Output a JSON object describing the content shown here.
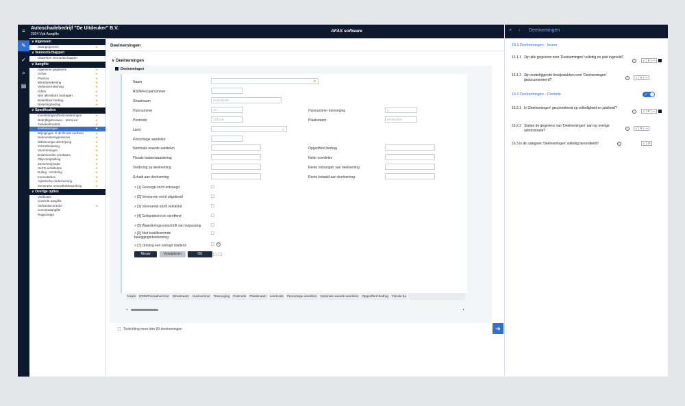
{
  "window": {
    "title": "Autoschadebedrijf \"De Uitdeuker\" B.V.",
    "subtitle": "2024 Vpb Aangifte",
    "brand": "AFAS software"
  },
  "rail_icons": [
    "menu-icon",
    "pencil-icon",
    "check-icon",
    "search-icon",
    "document-icon"
  ],
  "nav": {
    "sections": [
      {
        "title": "Algemeen",
        "items": [
          {
            "label": "Stamgegevens",
            "star": true
          }
        ]
      },
      {
        "title": "Vennootschappen",
        "items": [
          {
            "label": "Uitwerken vennootschappen",
            "star": false
          }
        ]
      },
      {
        "title": "Aangifte",
        "items": [
          {
            "label": "Algemene gegevens",
            "star": true
          },
          {
            "label": "Activa",
            "star": true
          },
          {
            "label": "Passiva",
            "star": true
          },
          {
            "label": "Winstberekening",
            "star": true
          },
          {
            "label": "Verliesverrekening",
            "star": true
          },
          {
            "label": "Giften",
            "star": true
          },
          {
            "label": "Niet aftrekbare bedragen",
            "star": true
          },
          {
            "label": "Belastbaar bedrag",
            "star": true
          },
          {
            "label": "Belastingbedrag",
            "star": true
          }
        ]
      },
      {
        "title": "Specificaties",
        "items": [
          {
            "label": "Investeringen/Desinvesteringen",
            "star": true
          },
          {
            "label": "Bedrijfsgebouwen - terreinen",
            "star": true
          },
          {
            "label": "Aandeelhouders",
            "star": true
          },
          {
            "label": "Deelnemingen",
            "star": true,
            "selected": true
          },
          {
            "label": "Wijzigingen in de fiscale eenheid",
            "star": true
          },
          {
            "label": "Herinvesteringsreserve",
            "star": true
          },
          {
            "label": "Willekeurige afschrijving",
            "star": true
          },
          {
            "label": "Omzetbelasting",
            "star": true
          },
          {
            "label": "Voorzieningen",
            "star": true
          },
          {
            "label": "Buitenlandse resultaten",
            "star": true
          },
          {
            "label": "Objectvrijstelling",
            "star": true
          },
          {
            "label": "Zeescheepvaart",
            "star": true
          },
          {
            "label": "HLFG activiteiten",
            "star": true
          },
          {
            "label": "Ruling - verdeling",
            "star": true
          },
          {
            "label": "Innovatiebox",
            "star": true
          },
          {
            "label": "Agrarische onderneming",
            "star": true
          },
          {
            "label": "Generieke renteaftrekbeperking",
            "star": true
          }
        ]
      },
      {
        "title": "Overige opties",
        "items": [
          {
            "label": "Verificatie",
            "star": false
          },
          {
            "label": "Controle aangifte",
            "star": false
          },
          {
            "label": "Verbandscontrole",
            "star": true
          },
          {
            "label": "Conceptaangifte",
            "star": false
          },
          {
            "label": "Rapportage",
            "star": false
          }
        ]
      }
    ]
  },
  "main": {
    "page_title": "Deelnemingen",
    "section_title": "Deelnemingen",
    "sub_title": "Deelnemingen",
    "fields": {
      "naam": "Naam",
      "rsin": "RSIN/Fiscaalnummer",
      "straatnaam": "Straatnaam",
      "straatnaam_ph": "Hoofdstraat",
      "huisnummer": "Huisnummer",
      "huisnummer_ph": "10",
      "huisnummer_toev": "Huisnummer toevoeging",
      "huisnummer_toev_ph": "A",
      "postcode": "Postcode",
      "postcode_ph": "1234AB",
      "plaatsnaam": "Plaatsnaam",
      "plaatsnaam_ph": "Amsterdam",
      "land": "Land",
      "percentage": "Percentage aandelen",
      "nominale": "Nominale waarde aandelen",
      "opgeofferd": "Opgeofferd bedrag",
      "fiscale_balans": "Fiscale balanswaardering",
      "netto": "Netto voordelen",
      "vordering": "Vordering op deelneming",
      "rente_ontv": "Rente ontvangen van deelneming",
      "schuld": "Schuld aan deelneming",
      "rente_bet": "Rente betaald aan deelneming"
    },
    "checks": [
      "> [1] Gevoegd en/of ontvoegd",
      "> [2] Verworven en/of uitgebreid",
      "> [3] Vervreemd en/of verkleind",
      "> [4] Geliquideerd en vereffend",
      "> [5] Waarderingsvoorschrift van toepassing",
      "> [6] Niet kwalificerende",
      "beleggingsdeelneming",
      "> [7] Onteing een verkapt dividend"
    ],
    "buttons": {
      "nieuw": "Nieuw",
      "verwijderen": "Verwijderen",
      "ok": "OK"
    },
    "table_headers": [
      "Naam",
      "RSIN/Fiscaalnummer",
      "Straatnaam",
      "Huisnummer",
      "Toevoeging",
      "Postcode",
      "Plaatsnaam",
      "Landcode",
      "Percentage aandelen",
      "Nominale waarde aandelen",
      "Opgeofferd bedrag",
      "Fiscale ba"
    ],
    "toelichting": "Toelichting meer dan 99 deelnemingen"
  },
  "panel": {
    "title": "Deelnemingen",
    "close": "×",
    "back": "‹",
    "s1": "16.1  Deelnemingen - Invoer",
    "q1_num": "16.1.1",
    "q1": "Zijn alle gegevens voor 'Deelnemingen' volledig en juist ingevuld?",
    "q2_num": "16.1.2",
    "q2": "Zijn onderliggende bewijsstukken voor 'Deelnemingen' gedocumenteerd?",
    "s2": "16.2  Deelnemingen - Controle",
    "q3_num": "16.2.1",
    "q3": "Is 'Deelnemingen' gecontroleerd op volledigheid en juistheid?",
    "q4_num": "16.2.2",
    "q4": "Sluiten de gegevens van 'Deelnemingen' aan op overige administratie?",
    "q5": "16.3  Is de categorie 'Deelnemingen' volledig beoordeeld?",
    "tri": [
      "✓",
      "✕",
      "—"
    ],
    "info": "i",
    "toggle_check": "✓"
  },
  "colors": {
    "navy": "#0d1a2e",
    "accent": "#2f6fd6",
    "star": "#f0a830"
  }
}
